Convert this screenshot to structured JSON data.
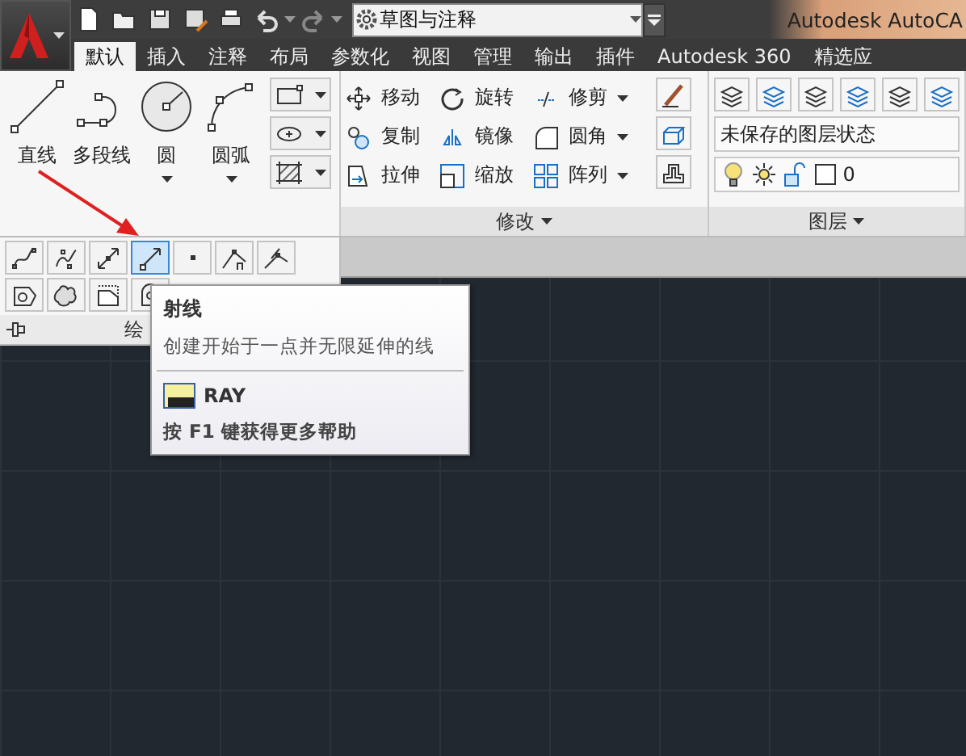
{
  "quick_access": {
    "workspace": "草图与注释"
  },
  "title": "Autodesk AutoCA",
  "tabs": [
    {
      "label": "默认",
      "selected": true
    },
    {
      "label": "插入",
      "selected": false
    },
    {
      "label": "注释",
      "selected": false
    },
    {
      "label": "布局",
      "selected": false
    },
    {
      "label": "参数化",
      "selected": false
    },
    {
      "label": "视图",
      "selected": false
    },
    {
      "label": "管理",
      "selected": false
    },
    {
      "label": "输出",
      "selected": false
    },
    {
      "label": "插件",
      "selected": false
    },
    {
      "label": "Autodesk 360",
      "selected": false
    },
    {
      "label": "精选应",
      "selected": false
    }
  ],
  "draw_panel": {
    "tools": [
      {
        "kind": "line",
        "label": "直线",
        "dropdown": false
      },
      {
        "kind": "polyline",
        "label": "多段线",
        "dropdown": false
      },
      {
        "kind": "circle",
        "label": "圆",
        "dropdown": true
      },
      {
        "kind": "arc",
        "label": "圆弧",
        "dropdown": true
      }
    ],
    "small_tools": [
      {
        "kind": "rectangle"
      },
      {
        "kind": "ellipse"
      },
      {
        "kind": "hatch"
      }
    ],
    "flyout_rows": [
      [
        {
          "kind": "spline-fit",
          "highlighted": false
        },
        {
          "kind": "spline-cv",
          "highlighted": false
        },
        {
          "kind": "xline",
          "highlighted": false
        },
        {
          "kind": "ray",
          "highlighted": true
        },
        {
          "kind": "point",
          "highlighted": false
        },
        {
          "kind": "divide",
          "highlighted": false
        },
        {
          "kind": "measure",
          "highlighted": false
        }
      ],
      [
        {
          "kind": "boundary",
          "highlighted": false
        },
        {
          "kind": "cloud",
          "highlighted": false
        },
        {
          "kind": "wipeout",
          "highlighted": false
        },
        {
          "kind": "region",
          "highlighted": false
        }
      ]
    ],
    "title": "绘"
  },
  "modify_panel": {
    "tools": [
      {
        "kind": "move",
        "label": "移动",
        "dropdown": false
      },
      {
        "kind": "rotate",
        "label": "旋转",
        "dropdown": false
      },
      {
        "kind": "trim",
        "label": "修剪",
        "dropdown": true
      },
      {
        "kind": "copy",
        "label": "复制",
        "dropdown": false
      },
      {
        "kind": "mirror",
        "label": "镜像",
        "dropdown": false
      },
      {
        "kind": "fillet",
        "label": "圆角",
        "dropdown": true
      },
      {
        "kind": "stretch",
        "label": "拉伸",
        "dropdown": false
      },
      {
        "kind": "scale",
        "label": "缩放",
        "dropdown": false
      },
      {
        "kind": "array",
        "label": "阵列",
        "dropdown": true
      }
    ],
    "title": "修改"
  },
  "layers_panel": {
    "layer_state": "未保存的图层状态",
    "current_layer": "0",
    "title": "图层"
  },
  "tooltip": {
    "title": "射线",
    "description": "创建开始于一点并无限延伸的线",
    "command": "RAY",
    "help": "按 F1 键获得更多帮助"
  }
}
